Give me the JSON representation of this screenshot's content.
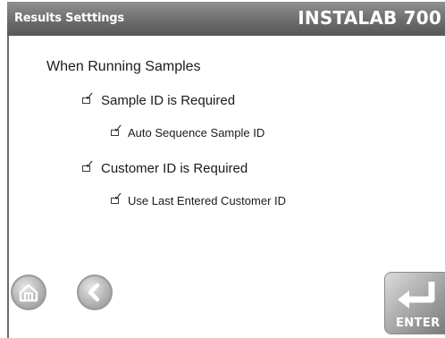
{
  "header": {
    "title": "Results Setttings",
    "brand": "INSTALAB 700"
  },
  "section_heading": "When Running Samples",
  "options": [
    {
      "label": "Sample ID is Required",
      "checked": true
    },
    {
      "label": "Auto Sequence Sample ID",
      "checked": true
    },
    {
      "label": "Customer ID is Required",
      "checked": true
    },
    {
      "label": "Use Last Entered Customer ID",
      "checked": true
    }
  ],
  "checkmark_glyph": "✓",
  "buttons": {
    "home_icon": "home-icon",
    "back_icon": "back-arrow-icon",
    "enter_label": "ENTER"
  },
  "colors": {
    "header_bg": "#6d6d6d",
    "header_text": "#ffffff",
    "button_gray": "#bdbdbd"
  }
}
